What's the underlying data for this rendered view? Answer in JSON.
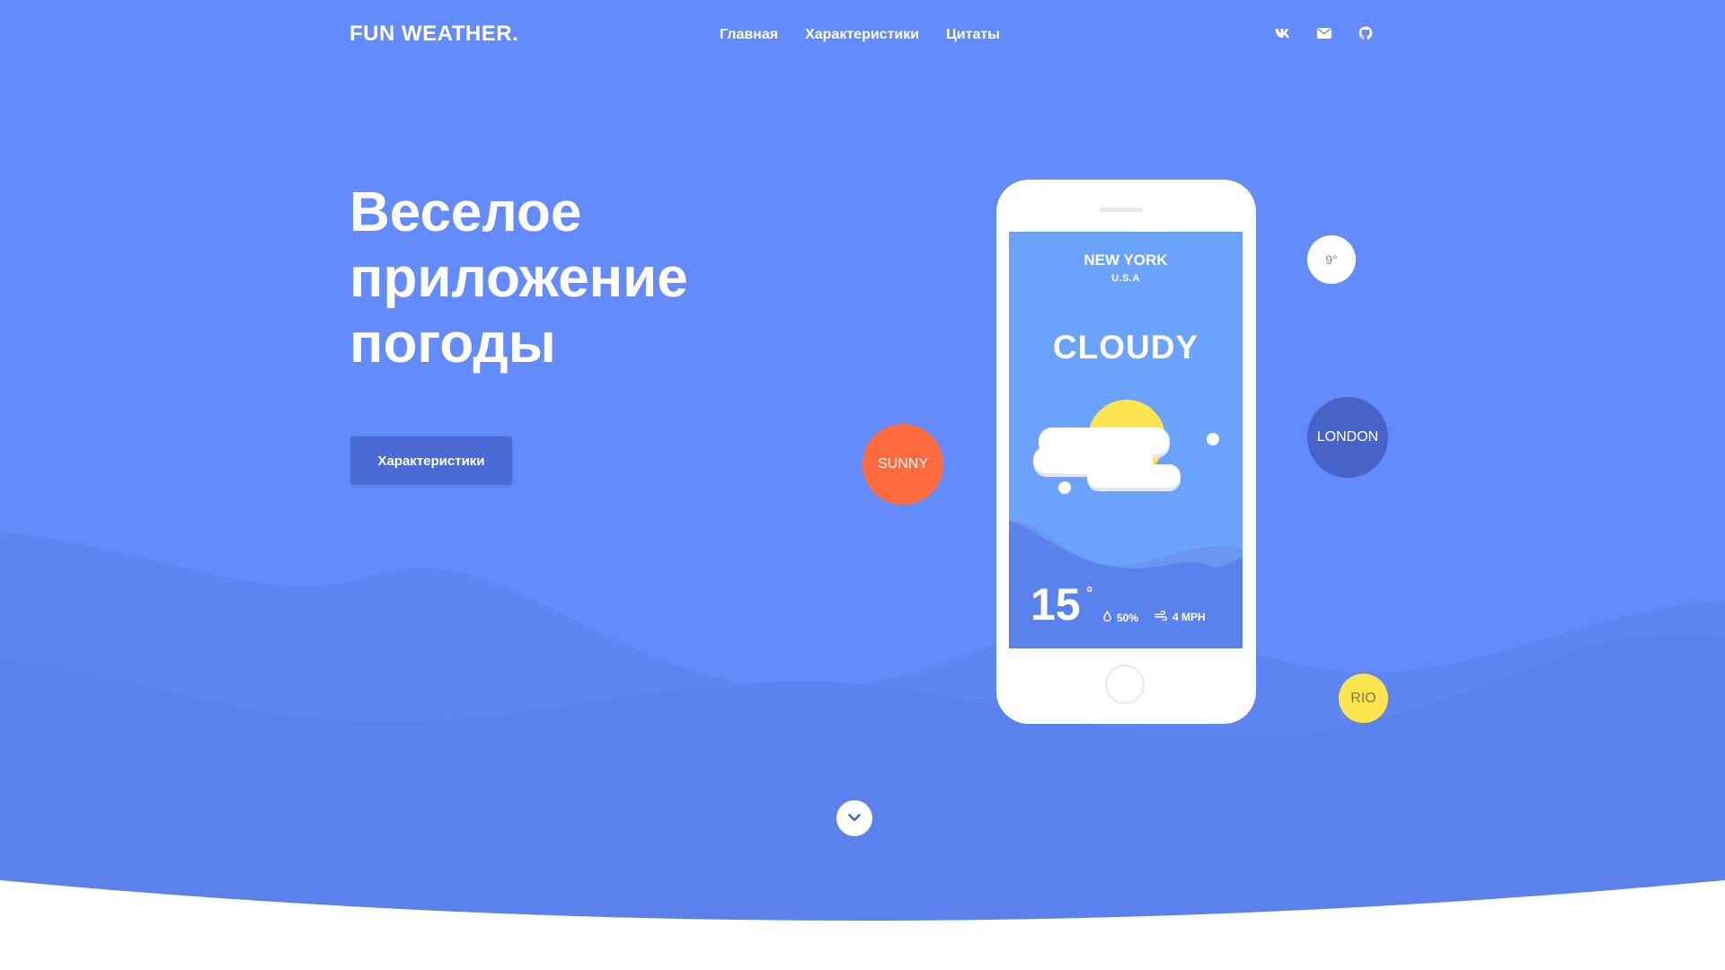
{
  "header": {
    "logo": "FUN WEATHER.",
    "nav": [
      {
        "label": "Главная"
      },
      {
        "label": "Характеристики"
      },
      {
        "label": "Цитаты"
      }
    ],
    "socials": [
      "vk-icon",
      "mail-icon",
      "github-icon"
    ]
  },
  "hero": {
    "title_lines": [
      "Веселое",
      "приложение",
      "погоды"
    ],
    "cta_label": "Характеристики"
  },
  "phone": {
    "city": "NEW YORK",
    "country": "U.S.A",
    "condition": "CLOUDY",
    "temperature": "15",
    "degree": "°",
    "humidity": "50%",
    "wind": "4 MPH"
  },
  "bubbles": {
    "sunny": "SUNNY",
    "temp": "9°",
    "london": "LONDON",
    "rio": "RIO"
  },
  "colors": {
    "background": "#638bfc",
    "accent_button": "#4a6bd4",
    "sunny": "#ff6b3d",
    "london": "#4762c9",
    "rio": "#fde54f",
    "sun": "#fde54f"
  }
}
